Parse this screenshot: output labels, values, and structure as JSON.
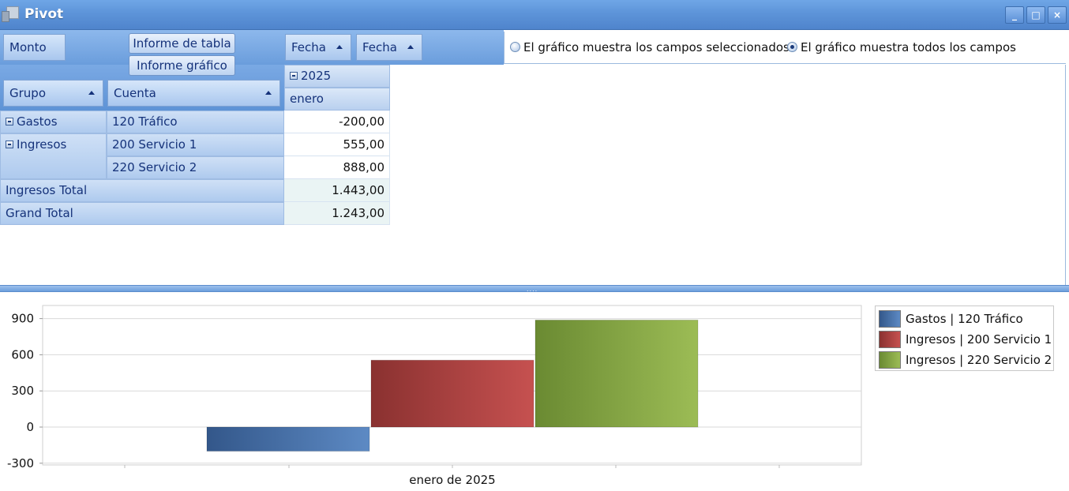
{
  "window": {
    "title": "Pivot",
    "minimize_label": "_",
    "maximize_label": "□",
    "close_label": "×"
  },
  "pivot": {
    "data_field": "Monto",
    "report_buttons": [
      "Informe de tabla",
      "Informe gráfico"
    ],
    "column_fields": [
      "Fecha",
      "Fecha"
    ],
    "row_fields": [
      "Grupo",
      "Cuenta"
    ],
    "column_headers": {
      "year": "2025",
      "month": "enero"
    },
    "rows": [
      {
        "group": "Gastos",
        "account": "120 Tráfico",
        "value": "-200,00"
      },
      {
        "group": "Ingresos",
        "account": "200 Servicio 1",
        "value": "555,00"
      },
      {
        "group": "",
        "account": "220 Servicio 2",
        "value": "888,00"
      }
    ],
    "subtotal": {
      "label": "Ingresos Total",
      "value": "1.443,00"
    },
    "grand_total": {
      "label": "Grand Total",
      "value": "1.243,00"
    }
  },
  "chart_options": {
    "option_selected": "El gráfico muestra los campos seleccionados",
    "option_all": "El gráfico muestra todos los campos",
    "checked": "option_all"
  },
  "colors": {
    "gastos_120": "#4a74ad",
    "ingresos_200": "#b04442",
    "ingresos_220": "#88a845"
  },
  "chart_data": {
    "type": "bar",
    "categories": [
      "enero de 2025"
    ],
    "series": [
      {
        "name": "Gastos | 120 Tráfico",
        "values": [
          -200
        ]
      },
      {
        "name": "Ingresos | 200 Servicio 1",
        "values": [
          555
        ]
      },
      {
        "name": "Ingresos | 220 Servicio 2",
        "values": [
          888
        ]
      }
    ],
    "yticks": [
      "900",
      "600",
      "300",
      "0",
      "-300"
    ],
    "ylim": [
      -300,
      1000
    ],
    "grid": true,
    "legend": "right"
  }
}
